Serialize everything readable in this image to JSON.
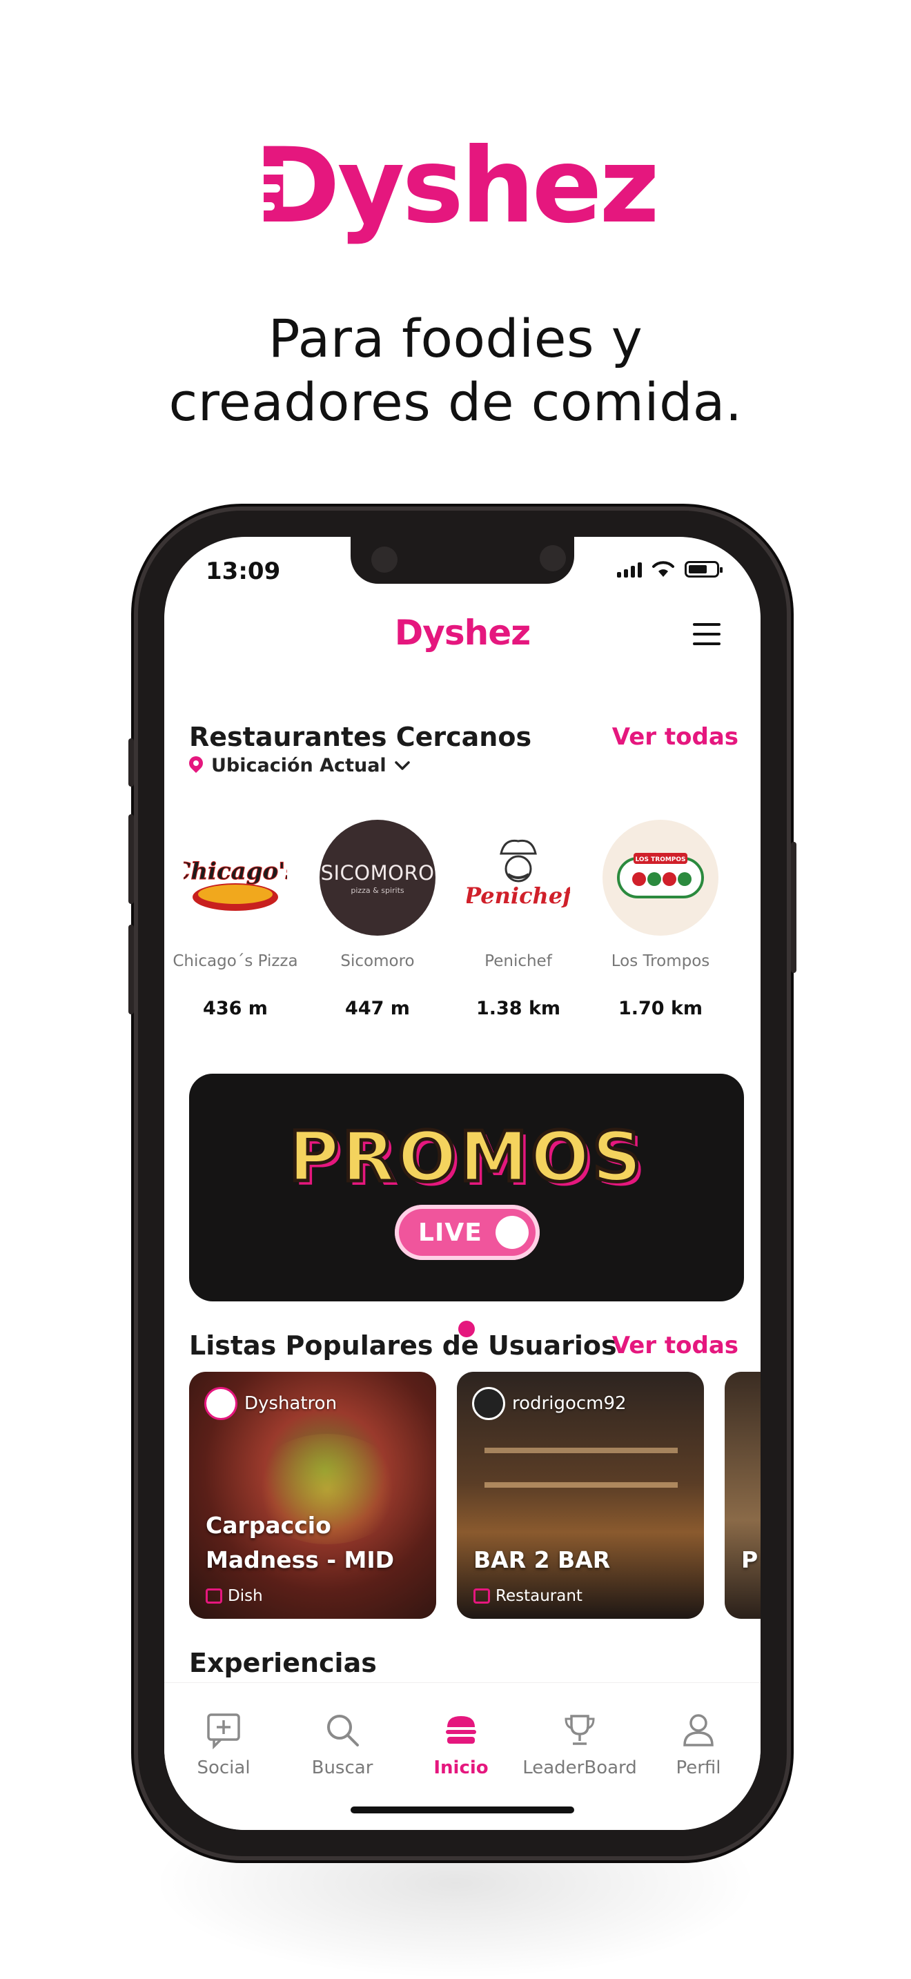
{
  "brand": {
    "name": "Dyshez",
    "accent": "#e5177e"
  },
  "headline": {
    "line1": "Para foodies y",
    "line2": "creadores de comida."
  },
  "status_bar": {
    "time": "13:09"
  },
  "app_header": {
    "logo": "Dyshez",
    "menu_icon": "hamburger-menu-icon"
  },
  "nearby": {
    "title": "Restaurantes Cercanos",
    "see_all": "Ver todas",
    "location_label": "Ubicación Actual",
    "restaurants": [
      {
        "name": "Chicago´s Pizza",
        "distance": "436 m",
        "logo_text": "Chicago's"
      },
      {
        "name": "Sicomoro",
        "distance": "447 m",
        "logo_text": "SICOMORO",
        "logo_sub": "pizza & spirits"
      },
      {
        "name": "Penichef",
        "distance": "1.38 km",
        "logo_text": "Penichef"
      },
      {
        "name": "Los Trompos",
        "distance": "1.70 km",
        "logo_text": "LOS TROMPOS"
      }
    ]
  },
  "promo_banner": {
    "title": "PROMOS",
    "badge": "LIVE"
  },
  "popular_lists": {
    "title": "Listas Populares de Usuarios",
    "see_all": "Ver todas",
    "cards": [
      {
        "user": "Dyshatron",
        "title_line1": "Carpaccio",
        "title_line2": "Madness - MID",
        "type": "Dish"
      },
      {
        "user": "rodrigocm92",
        "title_line1": "",
        "title_line2": "BAR 2 BAR",
        "type": "Restaurant"
      },
      {
        "user": "",
        "title_line1": "",
        "title_line2": "P",
        "type": ""
      }
    ]
  },
  "experiences": {
    "title": "Experiencias"
  },
  "tabbar": {
    "tabs": [
      {
        "label": "Social",
        "icon": "chat-plus-icon"
      },
      {
        "label": "Buscar",
        "icon": "search-icon"
      },
      {
        "label": "Inicio",
        "icon": "burger-icon",
        "active": true
      },
      {
        "label": "LeaderBoard",
        "icon": "trophy-icon"
      },
      {
        "label": "Perfil",
        "icon": "user-icon"
      }
    ]
  }
}
